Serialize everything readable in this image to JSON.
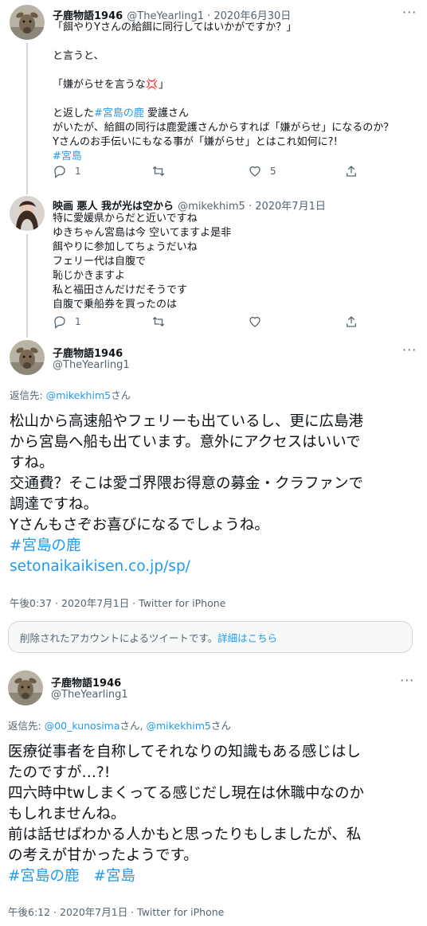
{
  "tweet1": {
    "name": "子鹿物語1946",
    "handle": "@TheYearling1",
    "date": " · 2020年6月30日",
    "lines": [
      "「餌やりYさんの給餌に同行してはいかがですか？」",
      "",
      "と言うと、",
      "",
      "「嫌がらせを言うな",
      "",
      "と返した",
      "がいたが、給餌の同行は鹿愛護さんからすれば「嫌がらせ」になるのか？",
      "Yさんのお手伝いにもなる事が「嫌がらせ」とはこれ如何に?!"
    ],
    "hashtag_miyajima_shika": "#宮島の鹿",
    "after_hashtag": " 愛護さん",
    "quote_close": "」",
    "hashtag_miyajima": "#宮島",
    "replies": "1",
    "likes": "5"
  },
  "tweet2": {
    "name": "映画 悪人 我が光は空から",
    "handle": "@mikekhim5",
    "date": " · 2020年7月1日",
    "lines": [
      "特に愛媛県からだと近いですね",
      "ゆきちゃん宮島は今 空いてますよ是非",
      "餌やりに参加してちょうだいね",
      "フェリー代は自腹で",
      "恥じかきますよ",
      "私と福田さんだけだそうです",
      "自腹で乗船券を買ったのは"
    ],
    "replies": "1"
  },
  "tweet3": {
    "name": "子鹿物語1946",
    "handle": "@TheYearling1",
    "reply_to_prefix": "返信先: ",
    "reply_to_user": "@mikekhim5",
    "reply_to_suffix": "さん",
    "lines": [
      "松山から高速船やフェリーも出ているし、更に広島港",
      "から宮島へ船も出ています。意外にアクセスはいいで",
      "すね。",
      "交通費？そこは愛ゴ界隈お得意の募金・クラファンで",
      "調達ですね。",
      "Yさんもさぞお喜びになるでしょうね。"
    ],
    "hashtag": "#宮島の鹿",
    "url": "setonaikaikisen.co.jp/sp/",
    "timestamp": "午後0:37 · 2020年7月1日 · Twitter for iPhone"
  },
  "deleted_notice": {
    "text": "削除されたアカウントによるツイートです。",
    "link": "詳細はこちら"
  },
  "tweet4": {
    "name": "子鹿物語1946",
    "handle": "@TheYearling1",
    "reply_to_prefix": "返信先: ",
    "reply_to_user1": "@00_kunosima",
    "reply_to_mid": "さん, ",
    "reply_to_user2": "@mikekhim5",
    "reply_to_suffix": "さん",
    "lines": [
      "医療従事者を自称してそれなりの知識もある感じはし",
      "たのですが…?!",
      "四六時中twしまくってる感じだし現在は休職中なのか",
      "もしれませんね。",
      "前は話せばわかる人かもと思ったりもしましたが、私",
      "の考えが甘かったようです。"
    ],
    "hashtag1": "#宮島の鹿",
    "hashtag2": "#宮島",
    "timestamp": "午後6:12 · 2020年7月1日 · Twitter for iPhone"
  },
  "more_label": "···",
  "colors": {
    "link": "#1d9bf0",
    "text": "#0f1419",
    "secondary": "#536471",
    "thread_line": "#cfd9de"
  },
  "icons": [
    "reply-icon",
    "retweet-icon",
    "like-icon",
    "share-icon",
    "more-icon",
    "anger-emoji-icon"
  ]
}
